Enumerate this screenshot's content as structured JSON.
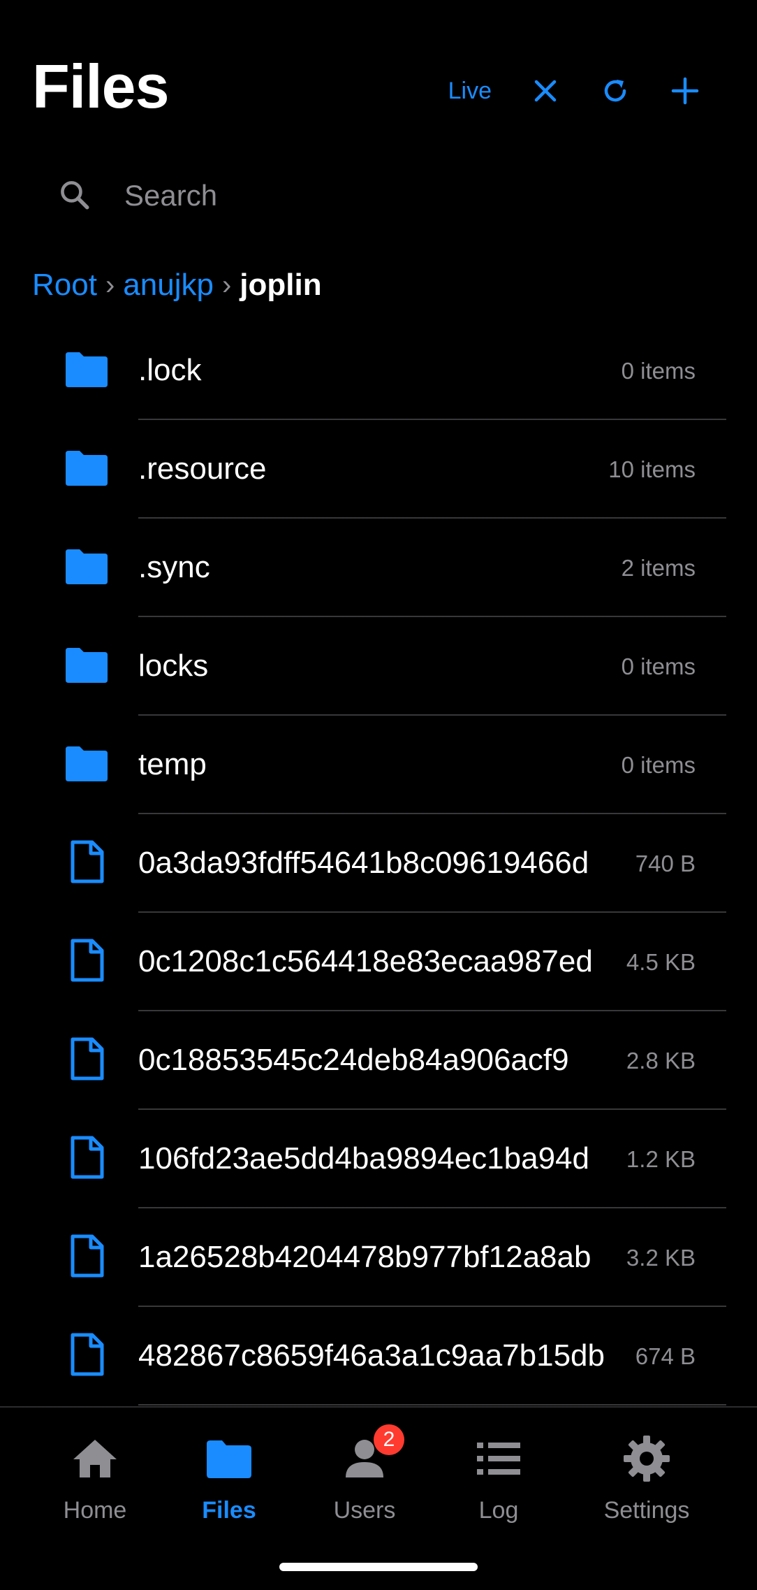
{
  "header": {
    "title": "Files",
    "live_label": "Live"
  },
  "search": {
    "placeholder": "Search"
  },
  "breadcrumb": {
    "items": [
      "Root",
      "anujkp"
    ],
    "current": "joplin",
    "separator": "›"
  },
  "rows": [
    {
      "type": "folder",
      "name": ".lock",
      "meta": "0 items"
    },
    {
      "type": "folder",
      "name": ".resource",
      "meta": "10 items"
    },
    {
      "type": "folder",
      "name": ".sync",
      "meta": "2 items"
    },
    {
      "type": "folder",
      "name": "locks",
      "meta": "0 items"
    },
    {
      "type": "folder",
      "name": "temp",
      "meta": "0 items"
    },
    {
      "type": "file",
      "name": "0a3da93fdff54641b8c09619466d",
      "meta": "740 B"
    },
    {
      "type": "file",
      "name": "0c1208c1c564418e83ecaa987ed",
      "meta": "4.5 KB"
    },
    {
      "type": "file",
      "name": "0c18853545c24deb84a906acf9",
      "meta": "2.8 KB"
    },
    {
      "type": "file",
      "name": "106fd23ae5dd4ba9894ec1ba94d",
      "meta": "1.2 KB"
    },
    {
      "type": "file",
      "name": "1a26528b4204478b977bf12a8ab",
      "meta": "3.2 KB"
    },
    {
      "type": "file",
      "name": "482867c8659f46a3a1c9aa7b15db",
      "meta": "674 B"
    }
  ],
  "tabs": [
    {
      "id": "home",
      "label": "Home",
      "icon": "house-icon"
    },
    {
      "id": "files",
      "label": "Files",
      "icon": "folder-icon",
      "active": true
    },
    {
      "id": "users",
      "label": "Users",
      "icon": "person-icon",
      "badge": "2"
    },
    {
      "id": "log",
      "label": "Log",
      "icon": "list-icon"
    },
    {
      "id": "settings",
      "label": "Settings",
      "icon": "gear-icon"
    }
  ],
  "colors": {
    "accent": "#1a8cff",
    "secondary_text": "#8e8e93",
    "badge": "#ff3b30",
    "background": "#000000"
  }
}
